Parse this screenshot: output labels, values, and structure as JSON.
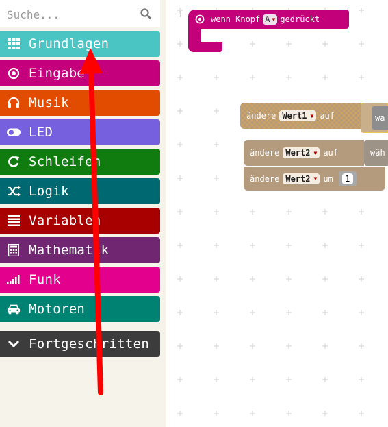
{
  "search": {
    "placeholder": "Suche..."
  },
  "categories": [
    {
      "label": "Grundlagen",
      "color": "#4bc4c4",
      "icon": "grid-icon"
    },
    {
      "label": "Eingabe",
      "color": "#c5007c",
      "icon": "target-icon"
    },
    {
      "label": "Musik",
      "color": "#e24c00",
      "icon": "headphones-icon"
    },
    {
      "label": "LED",
      "color": "#7660dd",
      "icon": "toggle-icon"
    },
    {
      "label": "Schleifen",
      "color": "#107c10",
      "icon": "loop-icon"
    },
    {
      "label": "Logik",
      "color": "#006870",
      "icon": "shuffle-icon"
    },
    {
      "label": "Variablen",
      "color": "#a80000",
      "icon": "list-icon"
    },
    {
      "label": "Mathematik",
      "color": "#712672",
      "icon": "calculator-icon"
    },
    {
      "label": "Funk",
      "color": "#e3008c",
      "icon": "signal-icon"
    },
    {
      "label": "Motoren",
      "color": "#008272",
      "icon": "car-icon"
    },
    {
      "label": "Fortgeschritten",
      "color": "#3c3c3c",
      "icon": "chevron-down-icon"
    }
  ],
  "blocks": {
    "event": {
      "prefix": "wenn Knopf",
      "button": "A",
      "suffix": "gedrückt"
    },
    "set1": {
      "prefix": "ändere",
      "var": "Wert1",
      "suffix": "auf",
      "slot": "wa"
    },
    "set2": {
      "prefix": "ändere",
      "var": "Wert2",
      "suffix": "auf",
      "slot": "wäh"
    },
    "change": {
      "prefix": "ändere",
      "var": "Wert2",
      "suffix": "um",
      "value": "1"
    }
  },
  "annotation": {
    "arrow_color": "#ff0000"
  }
}
